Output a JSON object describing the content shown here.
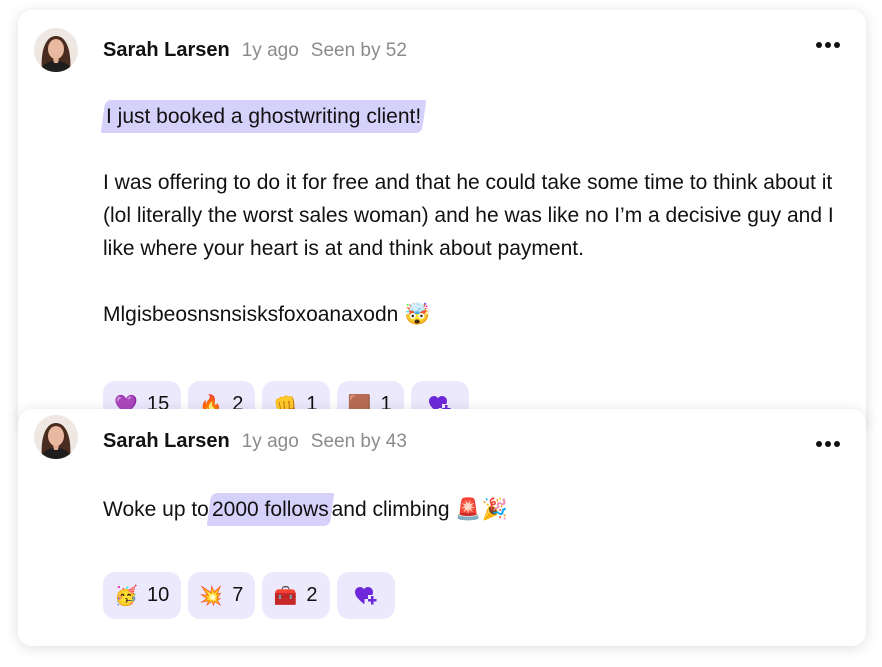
{
  "posts": [
    {
      "author": "Sarah Larsen",
      "time": "1y ago",
      "seen": "Seen by 52",
      "highlight": "I just booked a ghostwriting client!",
      "paragraph": "I was offering to do it for free and that he could take some time to think about it (lol literally the worst sales woman) and he was like no I’m a decisive guy and I like where your heart is at and think about payment.",
      "closing": "Mlgisbeosnsnsisksfoxoanaxodn",
      "closing_emoji": "🤯",
      "reactions": [
        {
          "emoji": "💜",
          "icon": "purple-heart-icon",
          "count": "15"
        },
        {
          "emoji": "🔥",
          "icon": "fire-icon",
          "count": "2"
        },
        {
          "emoji": "👊",
          "icon": "fist-bump-icon",
          "count": "1"
        },
        {
          "emoji": "🟫",
          "icon": "custom-emoji-icon",
          "count": "1"
        }
      ]
    },
    {
      "author": "Sarah Larsen",
      "time": "1y ago",
      "seen": "Seen by 43",
      "text_before": "Woke up to",
      "highlight": "2000 follows",
      "text_after": "and climbing",
      "trailing_emoji": "🚨🎉",
      "reactions": [
        {
          "emoji": "🥳",
          "icon": "party-face-icon",
          "count": "10"
        },
        {
          "emoji": "💥",
          "icon": "collision-icon",
          "count": "7"
        },
        {
          "emoji": "🧰",
          "icon": "toolbox-icon",
          "count": "2"
        }
      ]
    }
  ],
  "colors": {
    "highlight": "#d5d1fb",
    "chip_bg": "#ece9fd",
    "add_reaction": "#6d28d9",
    "meta": "#8b8b8b"
  },
  "icons": {
    "more": "more-horizontal-icon",
    "add_reaction": "heart-plus-icon"
  }
}
